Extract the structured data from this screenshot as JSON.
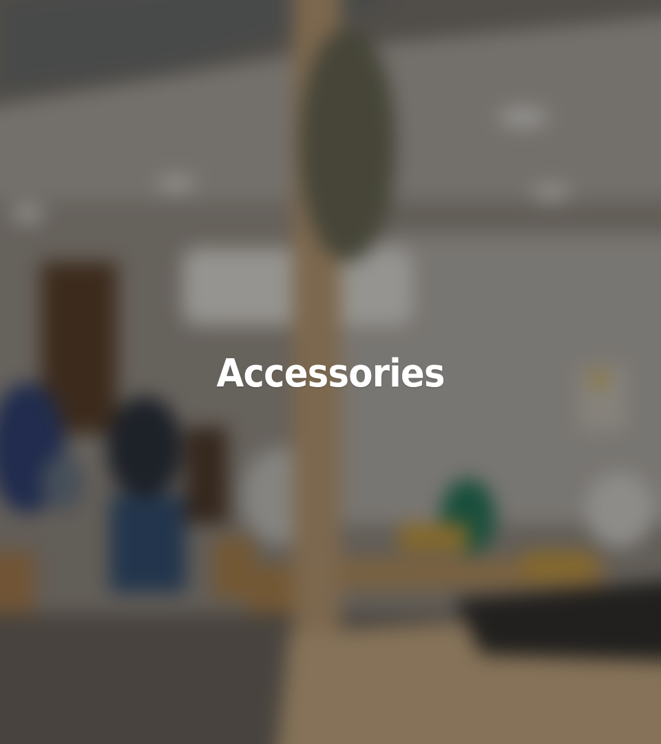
{
  "hero": {
    "title": "Accessories",
    "background_image": "blurred-cafe-interior",
    "overlay_color": "#141210"
  }
}
